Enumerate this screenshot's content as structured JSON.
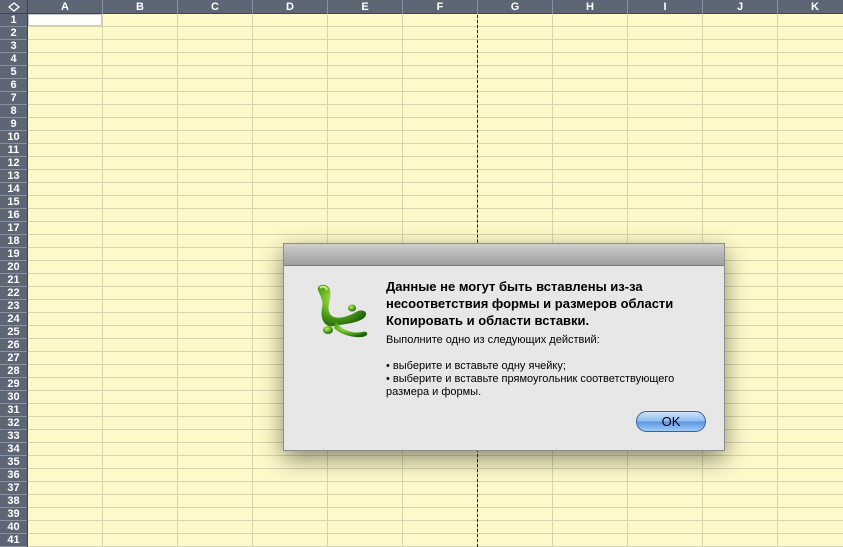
{
  "sheet": {
    "columns": [
      "A",
      "B",
      "C",
      "D",
      "E",
      "F",
      "G",
      "H",
      "I",
      "J",
      "K"
    ],
    "rows": [
      "1",
      "2",
      "3",
      "4",
      "5",
      "6",
      "7",
      "8",
      "9",
      "10",
      "11",
      "12",
      "13",
      "14",
      "15",
      "16",
      "17",
      "18",
      "19",
      "20",
      "21",
      "22",
      "23",
      "24",
      "25",
      "26",
      "27",
      "28",
      "29",
      "30",
      "31",
      "32",
      "33",
      "34",
      "35",
      "36",
      "37",
      "38",
      "39",
      "40",
      "41"
    ],
    "corner_icon": "select-all-diamond-icon",
    "cell_color": "#fdf9c9",
    "header_color": "#5d6674"
  },
  "dialog": {
    "icon": "excel-app-icon",
    "title": "Данные не могут быть вставлены из-за несоответствия формы и размеров области Копировать и области вставки.",
    "instruction": "Выполните одно из следующих действий:",
    "bullets": [
      "• выберите и вставьте одну ячейку;",
      "• выберите и вставьте прямоугольник соответствующего размера и формы."
    ],
    "ok_label": "OK"
  }
}
